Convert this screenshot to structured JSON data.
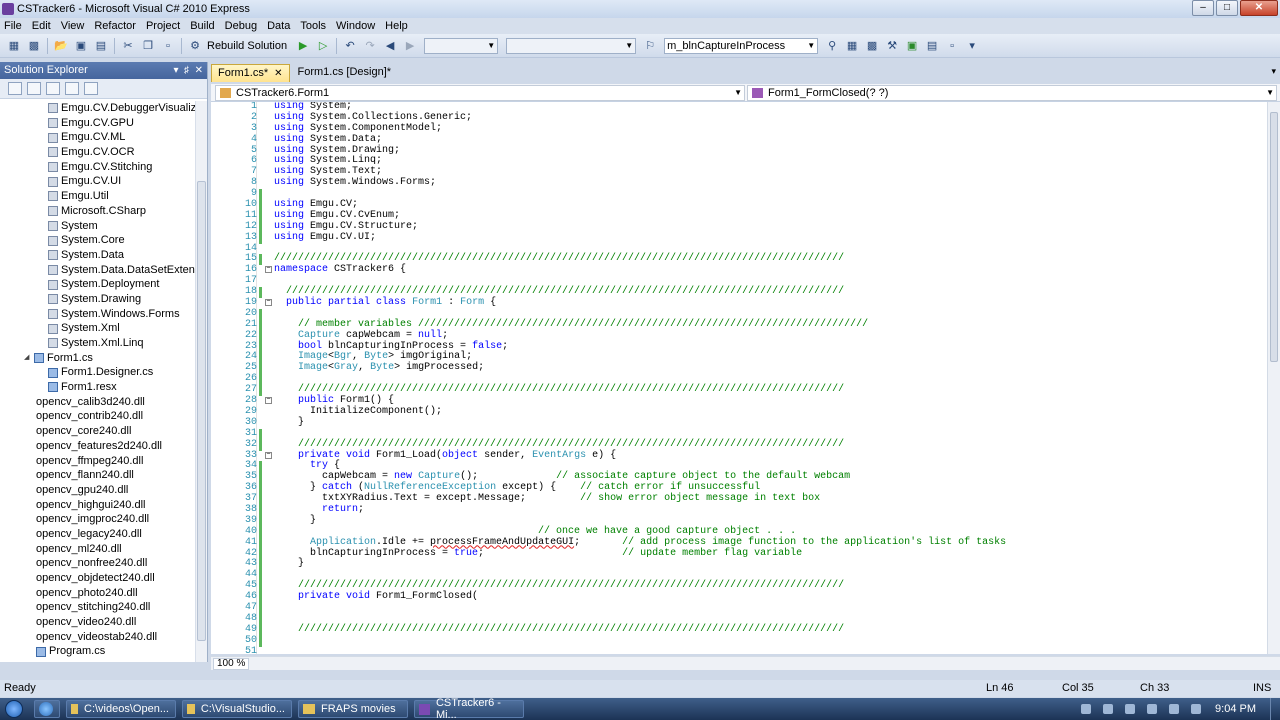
{
  "window": {
    "title": "CSTracker6 - Microsoft Visual C# 2010 Express"
  },
  "menu": [
    "File",
    "Edit",
    "View",
    "Refactor",
    "Project",
    "Build",
    "Debug",
    "Data",
    "Tools",
    "Window",
    "Help"
  ],
  "toolbar": {
    "rebuild_label": "Rebuild Solution",
    "find_combo_value": "m_blnCaptureInProcess"
  },
  "solution_explorer": {
    "title": "Solution Explorer",
    "items": [
      {
        "label": "Emgu.CV.DebuggerVisualizers",
        "kind": "ref",
        "indent": 3
      },
      {
        "label": "Emgu.CV.GPU",
        "kind": "ref",
        "indent": 3
      },
      {
        "label": "Emgu.CV.ML",
        "kind": "ref",
        "indent": 3
      },
      {
        "label": "Emgu.CV.OCR",
        "kind": "ref",
        "indent": 3
      },
      {
        "label": "Emgu.CV.Stitching",
        "kind": "ref",
        "indent": 3
      },
      {
        "label": "Emgu.CV.UI",
        "kind": "ref",
        "indent": 3
      },
      {
        "label": "Emgu.Util",
        "kind": "ref",
        "indent": 3
      },
      {
        "label": "Microsoft.CSharp",
        "kind": "ref",
        "indent": 3
      },
      {
        "label": "System",
        "kind": "ref",
        "indent": 3
      },
      {
        "label": "System.Core",
        "kind": "ref",
        "indent": 3
      },
      {
        "label": "System.Data",
        "kind": "ref",
        "indent": 3
      },
      {
        "label": "System.Data.DataSetExtensions",
        "kind": "ref",
        "indent": 3
      },
      {
        "label": "System.Deployment",
        "kind": "ref",
        "indent": 3
      },
      {
        "label": "System.Drawing",
        "kind": "ref",
        "indent": 3
      },
      {
        "label": "System.Windows.Forms",
        "kind": "ref",
        "indent": 3
      },
      {
        "label": "System.Xml",
        "kind": "ref",
        "indent": 3
      },
      {
        "label": "System.Xml.Linq",
        "kind": "ref",
        "indent": 3
      },
      {
        "label": "Form1.cs",
        "kind": "cs",
        "indent": 2,
        "expanded": true
      },
      {
        "label": "Form1.Designer.cs",
        "kind": "cs",
        "indent": 3
      },
      {
        "label": "Form1.resx",
        "kind": "cs",
        "indent": 3
      },
      {
        "label": "opencv_calib3d240.dll",
        "kind": "dll",
        "indent": 2
      },
      {
        "label": "opencv_contrib240.dll",
        "kind": "dll",
        "indent": 2
      },
      {
        "label": "opencv_core240.dll",
        "kind": "dll",
        "indent": 2
      },
      {
        "label": "opencv_features2d240.dll",
        "kind": "dll",
        "indent": 2
      },
      {
        "label": "opencv_ffmpeg240.dll",
        "kind": "dll",
        "indent": 2
      },
      {
        "label": "opencv_flann240.dll",
        "kind": "dll",
        "indent": 2
      },
      {
        "label": "opencv_gpu240.dll",
        "kind": "dll",
        "indent": 2
      },
      {
        "label": "opencv_highgui240.dll",
        "kind": "dll",
        "indent": 2
      },
      {
        "label": "opencv_imgproc240.dll",
        "kind": "dll",
        "indent": 2
      },
      {
        "label": "opencv_legacy240.dll",
        "kind": "dll",
        "indent": 2
      },
      {
        "label": "opencv_ml240.dll",
        "kind": "dll",
        "indent": 2
      },
      {
        "label": "opencv_nonfree240.dll",
        "kind": "dll",
        "indent": 2
      },
      {
        "label": "opencv_objdetect240.dll",
        "kind": "dll",
        "indent": 2
      },
      {
        "label": "opencv_photo240.dll",
        "kind": "dll",
        "indent": 2
      },
      {
        "label": "opencv_stitching240.dll",
        "kind": "dll",
        "indent": 2
      },
      {
        "label": "opencv_video240.dll",
        "kind": "dll",
        "indent": 2
      },
      {
        "label": "opencv_videostab240.dll",
        "kind": "dll",
        "indent": 2
      },
      {
        "label": "Program.cs",
        "kind": "cs",
        "indent": 2
      }
    ]
  },
  "tabs": [
    {
      "label": "Form1.cs*",
      "active": true,
      "closable": true
    },
    {
      "label": "Form1.cs [Design]*",
      "active": false,
      "closable": false
    }
  ],
  "navbar": {
    "type_value": "CSTracker6.Form1",
    "member_value": "Form1_FormClosed(? ?)"
  },
  "code_lines": [
    {
      "n": "1",
      "segs": [
        [
          "kw",
          "using"
        ],
        [
          "t",
          " System;"
        ]
      ]
    },
    {
      "n": "2",
      "segs": [
        [
          "kw",
          "using"
        ],
        [
          "t",
          " System.Collections.Generic;"
        ]
      ]
    },
    {
      "n": "3",
      "segs": [
        [
          "kw",
          "using"
        ],
        [
          "t",
          " System.ComponentModel;"
        ]
      ]
    },
    {
      "n": "4",
      "segs": [
        [
          "kw",
          "using"
        ],
        [
          "t",
          " System.Data;"
        ]
      ]
    },
    {
      "n": "5",
      "segs": [
        [
          "kw",
          "using"
        ],
        [
          "t",
          " System.Drawing;"
        ]
      ]
    },
    {
      "n": "6",
      "segs": [
        [
          "kw",
          "using"
        ],
        [
          "t",
          " System.Linq;"
        ]
      ]
    },
    {
      "n": "7",
      "segs": [
        [
          "kw",
          "using"
        ],
        [
          "t",
          " System.Text;"
        ]
      ]
    },
    {
      "n": "8",
      "segs": [
        [
          "kw",
          "using"
        ],
        [
          "t",
          " System.Windows.Forms;"
        ]
      ]
    },
    {
      "n": "9",
      "segs": [],
      "chg": true
    },
    {
      "n": "10",
      "segs": [
        [
          "kw",
          "using"
        ],
        [
          "t",
          " Emgu.CV;"
        ]
      ],
      "chg": true
    },
    {
      "n": "11",
      "segs": [
        [
          "kw",
          "using"
        ],
        [
          "t",
          " Emgu.CV.CvEnum;"
        ]
      ],
      "chg": true
    },
    {
      "n": "12",
      "segs": [
        [
          "kw",
          "using"
        ],
        [
          "t",
          " Emgu.CV.Structure;"
        ]
      ],
      "chg": true
    },
    {
      "n": "13",
      "segs": [
        [
          "kw",
          "using"
        ],
        [
          "t",
          " Emgu.CV.UI;"
        ]
      ],
      "chg": true
    },
    {
      "n": "14",
      "segs": []
    },
    {
      "n": "15",
      "segs": [
        [
          "cm",
          "///////////////////////////////////////////////////////////////////////////////////////////////"
        ]
      ],
      "chg": true
    },
    {
      "n": "16",
      "segs": [
        [
          "kw",
          "namespace"
        ],
        [
          "t",
          " CSTracker6 {"
        ]
      ],
      "fold": true
    },
    {
      "n": "17",
      "segs": []
    },
    {
      "n": "18",
      "segs": [
        [
          "cm",
          "  /////////////////////////////////////////////////////////////////////////////////////////////"
        ]
      ],
      "chg": true
    },
    {
      "n": "19",
      "segs": [
        [
          "t",
          "  "
        ],
        [
          "kw",
          "public partial class"
        ],
        [
          "t",
          " "
        ],
        [
          "ty",
          "Form1"
        ],
        [
          "t",
          " : "
        ],
        [
          "ty",
          "Form"
        ],
        [
          "t",
          " {"
        ]
      ],
      "fold": true
    },
    {
      "n": "20",
      "segs": [],
      "chg": true
    },
    {
      "n": "21",
      "segs": [
        [
          "cm",
          "    // member variables ///////////////////////////////////////////////////////////////////////////"
        ]
      ],
      "chg": true
    },
    {
      "n": "22",
      "segs": [
        [
          "t",
          "    "
        ],
        [
          "ty",
          "Capture"
        ],
        [
          "t",
          " capWebcam = "
        ],
        [
          "kw",
          "null"
        ],
        [
          "t",
          ";"
        ]
      ],
      "chg": true
    },
    {
      "n": "23",
      "segs": [
        [
          "t",
          "    "
        ],
        [
          "kw",
          "bool"
        ],
        [
          "t",
          " blnCapturingInProcess = "
        ],
        [
          "kw",
          "false"
        ],
        [
          "t",
          ";"
        ]
      ],
      "chg": true
    },
    {
      "n": "24",
      "segs": [
        [
          "t",
          "    "
        ],
        [
          "ty",
          "Image"
        ],
        [
          "t",
          "<"
        ],
        [
          "ty",
          "Bgr"
        ],
        [
          "t",
          ", "
        ],
        [
          "ty",
          "Byte"
        ],
        [
          "t",
          "> imgOriginal;"
        ]
      ],
      "chg": true
    },
    {
      "n": "25",
      "segs": [
        [
          "t",
          "    "
        ],
        [
          "ty",
          "Image"
        ],
        [
          "t",
          "<"
        ],
        [
          "ty",
          "Gray"
        ],
        [
          "t",
          ", "
        ],
        [
          "ty",
          "Byte"
        ],
        [
          "t",
          "> imgProcessed;"
        ]
      ],
      "chg": true
    },
    {
      "n": "26",
      "segs": [],
      "chg": true
    },
    {
      "n": "27",
      "segs": [
        [
          "cm",
          "    ///////////////////////////////////////////////////////////////////////////////////////////"
        ]
      ],
      "chg": true
    },
    {
      "n": "28",
      "segs": [
        [
          "t",
          "    "
        ],
        [
          "kw",
          "public"
        ],
        [
          "t",
          " Form1() {"
        ]
      ],
      "fold": true
    },
    {
      "n": "29",
      "segs": [
        [
          "t",
          "      InitializeComponent();"
        ]
      ]
    },
    {
      "n": "30",
      "segs": [
        [
          "t",
          "    }"
        ]
      ]
    },
    {
      "n": "31",
      "segs": [],
      "chg": true
    },
    {
      "n": "32",
      "segs": [
        [
          "cm",
          "    ///////////////////////////////////////////////////////////////////////////////////////////"
        ]
      ],
      "chg": true
    },
    {
      "n": "33",
      "segs": [
        [
          "t",
          "    "
        ],
        [
          "kw",
          "private void"
        ],
        [
          "t",
          " Form1_Load("
        ],
        [
          "kw",
          "object"
        ],
        [
          "t",
          " sender, "
        ],
        [
          "ty",
          "EventArgs"
        ],
        [
          "t",
          " e) {"
        ]
      ],
      "fold": true
    },
    {
      "n": "34",
      "segs": [
        [
          "t",
          "      "
        ],
        [
          "kw",
          "try"
        ],
        [
          "t",
          " {"
        ]
      ],
      "chg": true
    },
    {
      "n": "35",
      "segs": [
        [
          "t",
          "        capWebcam = "
        ],
        [
          "kw",
          "new"
        ],
        [
          "t",
          " "
        ],
        [
          "ty",
          "Capture"
        ],
        [
          "t",
          "();             "
        ],
        [
          "cm",
          "// associate capture object to the default webcam"
        ]
      ],
      "chg": true
    },
    {
      "n": "36",
      "segs": [
        [
          "t",
          "      } "
        ],
        [
          "kw",
          "catch"
        ],
        [
          "t",
          " ("
        ],
        [
          "ty",
          "NullReferenceException"
        ],
        [
          "t",
          " except) {    "
        ],
        [
          "cm",
          "// catch error if unsuccessful"
        ]
      ],
      "chg": true
    },
    {
      "n": "37",
      "segs": [
        [
          "t",
          "        txtXYRadius.Text = except.Message;         "
        ],
        [
          "cm",
          "// show error object message in text box"
        ]
      ],
      "chg": true
    },
    {
      "n": "38",
      "segs": [
        [
          "t",
          "        "
        ],
        [
          "kw",
          "return"
        ],
        [
          "t",
          ";"
        ]
      ],
      "chg": true
    },
    {
      "n": "39",
      "segs": [
        [
          "t",
          "      }"
        ]
      ],
      "chg": true
    },
    {
      "n": "40",
      "segs": [
        [
          "t",
          "                                            "
        ],
        [
          "cm",
          "// once we have a good capture object . . ."
        ]
      ],
      "chg": true
    },
    {
      "n": "41",
      "segs": [
        [
          "t",
          "      "
        ],
        [
          "ty",
          "Application"
        ],
        [
          "t",
          ".Idle += "
        ],
        [
          "err",
          "processFrameAndUpdateGUI"
        ],
        [
          "t",
          ";       "
        ],
        [
          "cm",
          "// add process image function to the application's list of tasks"
        ]
      ],
      "chg": true
    },
    {
      "n": "42",
      "segs": [
        [
          "t",
          "      blnCapturingInProcess = "
        ],
        [
          "kw",
          "true"
        ],
        [
          "t",
          ";                       "
        ],
        [
          "cm",
          "// update member flag variable"
        ]
      ],
      "chg": true
    },
    {
      "n": "43",
      "segs": [
        [
          "t",
          "    }"
        ]
      ],
      "chg": true
    },
    {
      "n": "44",
      "segs": [],
      "chg": true
    },
    {
      "n": "45",
      "segs": [
        [
          "cm",
          "    ///////////////////////////////////////////////////////////////////////////////////////////"
        ]
      ],
      "chg": true
    },
    {
      "n": "46",
      "segs": [
        [
          "t",
          "    "
        ],
        [
          "kw",
          "private void"
        ],
        [
          "t",
          " Form1_FormClosed("
        ]
      ],
      "chg": true
    },
    {
      "n": "47",
      "segs": [],
      "chg": true
    },
    {
      "n": "48",
      "segs": [],
      "chg": true
    },
    {
      "n": "49",
      "segs": [
        [
          "cm",
          "    ///////////////////////////////////////////////////////////////////////////////////////////"
        ]
      ],
      "chg": true
    },
    {
      "n": "50",
      "segs": [],
      "chg": true
    },
    {
      "n": "51",
      "segs": []
    }
  ],
  "syntax_colors": {
    "kw": "#0000ff",
    "ty": "#2b91af",
    "cm": "#008000",
    "t": "#000000",
    "err": "#000000"
  },
  "editor": {
    "zoom": "100 %"
  },
  "status": {
    "text": "Ready",
    "ln": "Ln 46",
    "col": "Col 35",
    "ch": "Ch 33",
    "mode": "INS"
  },
  "taskbar": {
    "items": [
      {
        "label": "C:\\videos\\Open...",
        "icon": "folder"
      },
      {
        "label": "C:\\VisualStudio...",
        "icon": "folder"
      },
      {
        "label": "FRAPS movies",
        "icon": "folder"
      },
      {
        "label": "CSTracker6 - Mi...",
        "icon": "vs"
      }
    ],
    "clock": "9:04 PM"
  }
}
